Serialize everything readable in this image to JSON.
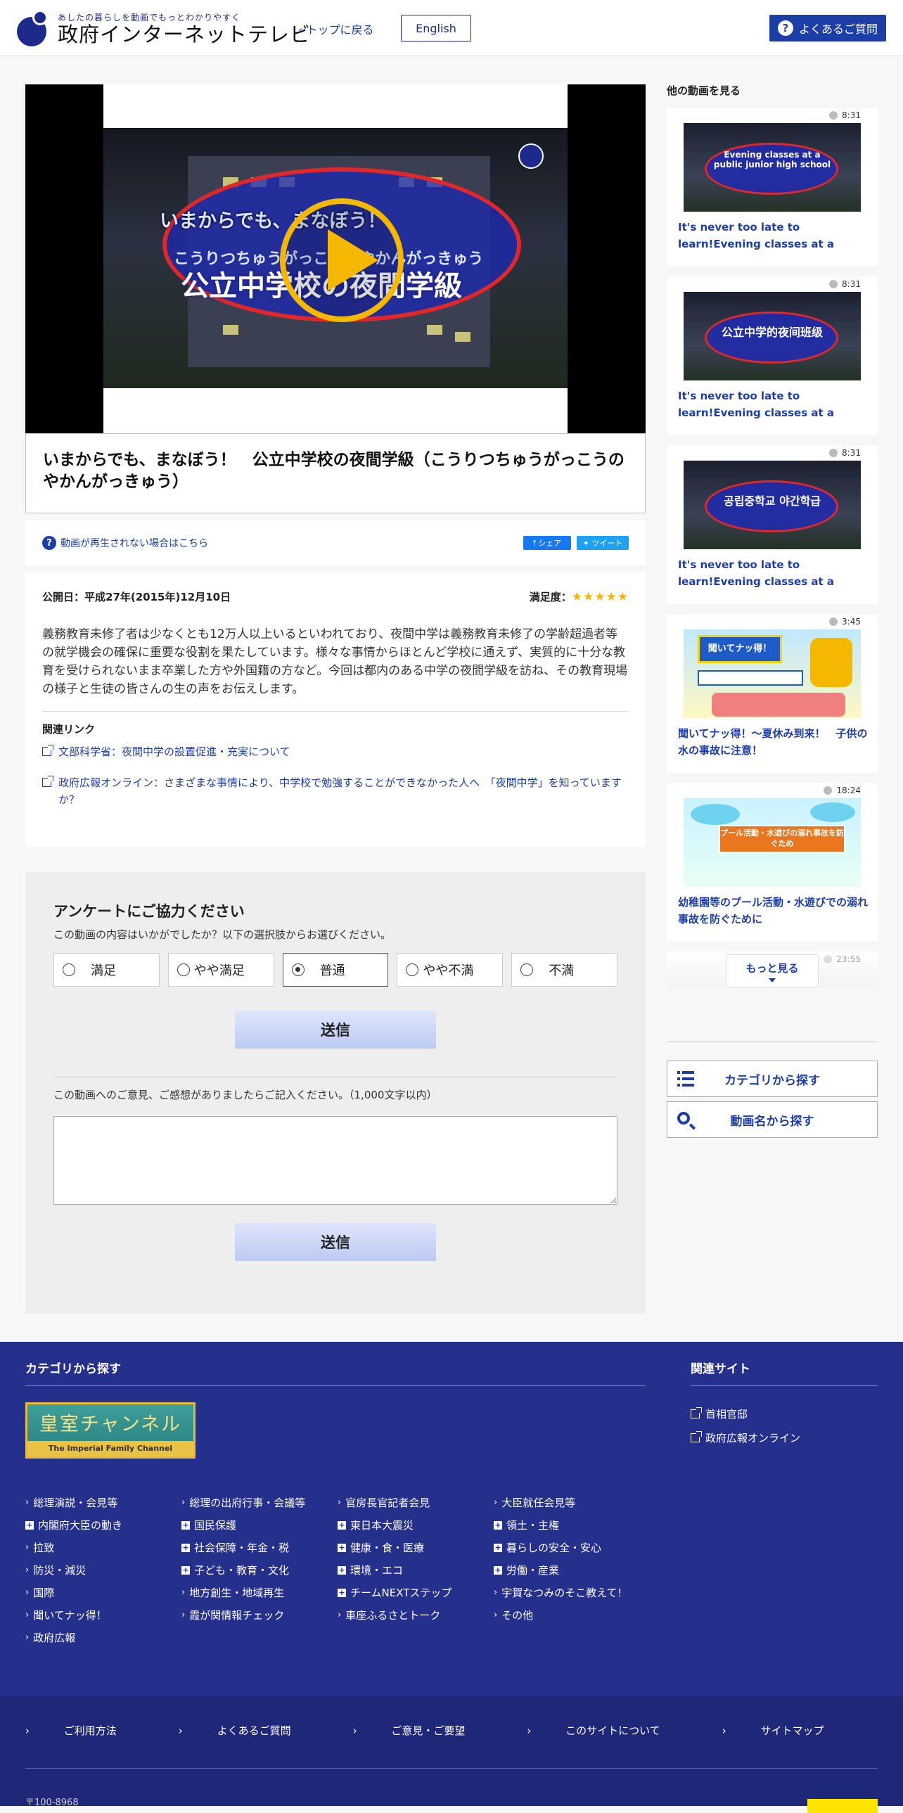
{
  "header": {
    "logo_sub": "あしたの暮らしを動画でもっとわかりやすく",
    "logo_main": "政府インターネットテレビ",
    "back_top": "トップに戻る",
    "english": "English",
    "faq": "よくあるご質問"
  },
  "video": {
    "overlay_line1": "いまからでも、まなぼう！",
    "overlay_line2": "こうりつちゅうがっこうのやかんがっきゅう",
    "overlay_line3": "公立中学校の夜間学級",
    "title": "いまからでも、まなぼう！　公立中学校の夜間学級（こうりつちゅうがっこうのやかんがっきゅう）",
    "help_text": "動画が再生されない場合はこちら",
    "share_fb": "シェア",
    "share_tw": "ツイート",
    "published": "公開日：平成27年(2015年)12月10日",
    "rating_label": "満足度：",
    "rating_stars": 5,
    "rating_glyphs": "★★★★★",
    "description": "義務教育未修了者は少なくとも12万人以上いるといわれており、夜間中学は義務教育未修了の学齢超過者等の就学機会の確保に重要な役割を果たしています。様々な事情からほとんど学校に通えず、実質的に十分な教育を受けられないまま卒業した方や外国籍の方など。今回は都内のある中学の夜間学級を訪ね、その教育現場の様子と生徒の皆さんの生の声をお伝えします。",
    "related_heading": "関連リンク",
    "related_links": [
      "文部科学省：夜間中学の設置促進・充実について",
      "政府広報オンライン：さまざまな事情により、中学校で勉強することができなかった人へ　「夜間中学」を知っていますか？"
    ]
  },
  "survey": {
    "heading": "アンケートにご協力ください",
    "question": "この動画の内容はいかがでしたか？以下の選択肢からお選びください。",
    "options": [
      "満足",
      "やや満足",
      "普通",
      "やや不満",
      "不満"
    ],
    "selected": "普通",
    "submit": "送信",
    "comment_label": "この動画へのご意見、ご感想がありましたらご記入ください。（1,000文字以内）",
    "comment_value": ""
  },
  "sidebar": {
    "heading": "他の動画を見る",
    "videos": [
      {
        "duration": "8:31",
        "title": "It's never too late to learn!Evening classes at a public junior high s...",
        "thumb_text": "Evening classes at a public junior high school"
      },
      {
        "duration": "8:31",
        "title": "It's never too late to learn!Evening classes at a public junior high s...",
        "thumb_text": "公立中学的夜间班级"
      },
      {
        "duration": "8:31",
        "title": "It's never too late to learn!Evening classes at a public junior high s...",
        "thumb_text": "공립중학교 야간학급"
      },
      {
        "duration": "3:45",
        "title": "聞いてナッ得！～夏休み到来！　子供の水の事故に注意！",
        "thumb_text": "聞いてナッ得！"
      },
      {
        "duration": "18:24",
        "title": "幼稚園等のプール活動・水遊びでの溺れ事故を防ぐために",
        "thumb_text": "プール活動・水遊びの溺れ事故を防ぐため"
      }
    ],
    "faded_duration": "23:55",
    "more": "もっと見る",
    "cat_button": "カテゴリから探す",
    "name_button": "動画名から探す"
  },
  "footer": {
    "cat_heading": "カテゴリから探す",
    "related_heading": "関連サイト",
    "imperial_jp": "皇室チャンネル",
    "imperial_en": "The Imperial Family Channel",
    "categories": [
      {
        "label": "総理演説・会見等",
        "type": "chev"
      },
      {
        "label": "総理の出府行事・会議等",
        "type": "chev"
      },
      {
        "label": "官房長官記者会見",
        "type": "chev"
      },
      {
        "label": "大臣就任会見等",
        "type": "chev"
      },
      {
        "label": "内閣府大臣の動き",
        "type": "plus"
      },
      {
        "label": "国民保護",
        "type": "plus"
      },
      {
        "label": "東日本大震災",
        "type": "plus"
      },
      {
        "label": "領土・主権",
        "type": "plus"
      },
      {
        "label": "拉致",
        "type": "chev"
      },
      {
        "label": "社会保障・年金・税",
        "type": "plus"
      },
      {
        "label": "健康・食・医療",
        "type": "plus"
      },
      {
        "label": "暮らしの安全・安心",
        "type": "plus"
      },
      {
        "label": "防災・減災",
        "type": "chev"
      },
      {
        "label": "子ども・教育・文化",
        "type": "plus"
      },
      {
        "label": "環境・エコ",
        "type": "plus"
      },
      {
        "label": "労働・産業",
        "type": "plus"
      },
      {
        "label": "国際",
        "type": "chev"
      },
      {
        "label": "地方創生・地域再生",
        "type": "chev"
      },
      {
        "label": "チームNEXTステップ",
        "type": "plus"
      },
      {
        "label": "宇賀なつみのそこ教えて！",
        "type": "chev"
      },
      {
        "label": "聞いてナッ得！",
        "type": "chev"
      },
      {
        "label": "霞が関情報チェック",
        "type": "chev"
      },
      {
        "label": "車座ふるさとトーク",
        "type": "chev"
      },
      {
        "label": "その他",
        "type": "chev"
      },
      {
        "label": "政府広報",
        "type": "chev"
      }
    ],
    "related_sites": [
      "首相官邸",
      "政府広報オンライン"
    ],
    "bottom_links": [
      "ご利用方法",
      "よくあるご質問",
      "ご意見・ご要望",
      "このサイトについて",
      "サイトマップ"
    ],
    "address": "〒100-8968"
  }
}
